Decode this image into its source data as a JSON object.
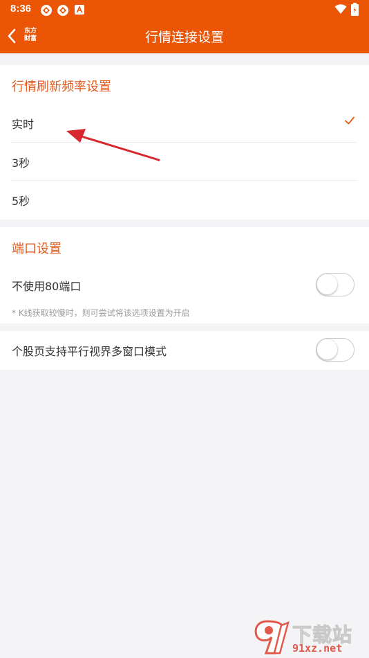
{
  "status_bar": {
    "time": "8:36",
    "icons": [
      "app-notification-icon",
      "app-notification-icon",
      "a-notification-icon",
      "wifi-icon",
      "battery-icon"
    ]
  },
  "app_bar": {
    "back_icon": "chevron-left-icon",
    "brand_line1": "东方",
    "brand_line2": "财富",
    "title": "行情连接设置"
  },
  "refresh_section": {
    "title": "行情刷新频率设置",
    "options": [
      {
        "label": "实时",
        "selected": true
      },
      {
        "label": "3秒",
        "selected": false
      },
      {
        "label": "5秒",
        "selected": false
      }
    ]
  },
  "port_section": {
    "title": "端口设置",
    "no_port_80": {
      "label": "不使用80端口",
      "enabled": false
    },
    "hint": "* K线获取较慢时，则可尝试将该选项设置为开启"
  },
  "parallel_view": {
    "label": "个股页支持平行视界多窗口模式",
    "enabled": false
  },
  "watermark": {
    "text": "下载站",
    "url": "91xz.net"
  },
  "colors": {
    "accent": "#ea5506",
    "section_title": "#e3581c",
    "background": "#f4f4f6",
    "annotation_arrow": "#d8262e"
  }
}
